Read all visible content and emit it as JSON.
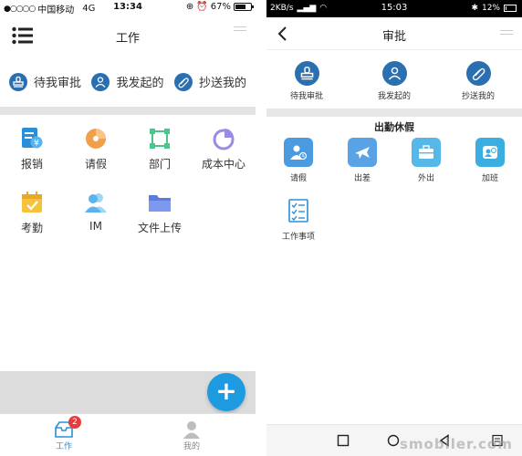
{
  "left": {
    "status": {
      "dots": "●○○○○",
      "carrier": "中国移动",
      "network": "4G",
      "time": "13:34",
      "battery": "67%",
      "battery_level": 0.67
    },
    "title": "工作",
    "quick": [
      {
        "label": "待我审批",
        "icon": "stamp-icon"
      },
      {
        "label": "我发起的",
        "icon": "user-plus-icon"
      },
      {
        "label": "抄送我的",
        "icon": "paperclip-icon"
      }
    ],
    "grid": [
      {
        "label": "报销",
        "icon": "reimburse-icon"
      },
      {
        "label": "请假",
        "icon": "leave-icon"
      },
      {
        "label": "部门",
        "icon": "department-icon"
      },
      {
        "label": "成本中心",
        "icon": "cost-center-icon"
      },
      {
        "label": "考勤",
        "icon": "attendance-icon"
      },
      {
        "label": "IM",
        "icon": "im-icon"
      },
      {
        "label": "文件上传",
        "icon": "folder-icon"
      }
    ],
    "fab": "+",
    "tabs": [
      {
        "label": "工作",
        "badge": "2",
        "active": true
      },
      {
        "label": "我的",
        "active": false
      }
    ]
  },
  "right": {
    "status": {
      "speed": "2KB/s",
      "time": "15:03",
      "battery": "12%",
      "battery_level": 0.12
    },
    "title": "审批",
    "quick": [
      {
        "label": "待我审批",
        "icon": "stamp-icon"
      },
      {
        "label": "我发起的",
        "icon": "user-plus-icon"
      },
      {
        "label": "抄送我的",
        "icon": "paperclip-icon"
      }
    ],
    "section": "出勤休假",
    "items": [
      {
        "label": "请假",
        "icon": "leave-person-icon",
        "color": "#4a9be0"
      },
      {
        "label": "出差",
        "icon": "airplane-icon",
        "color": "#5aa2e6"
      },
      {
        "label": "外出",
        "icon": "briefcase-icon",
        "color": "#55b8e8"
      },
      {
        "label": "加班",
        "icon": "overtime-icon",
        "color": "#3aaee0"
      },
      {
        "label": "工作事项",
        "icon": "checklist-icon",
        "color": "#2a8fd8"
      }
    ]
  },
  "colors": {
    "accent": "#2a8fd8",
    "fab": "#1e9be0",
    "quick_circle": "#2a6fb0",
    "badge": "#e93b3b"
  },
  "watermark": "smobiler.com"
}
